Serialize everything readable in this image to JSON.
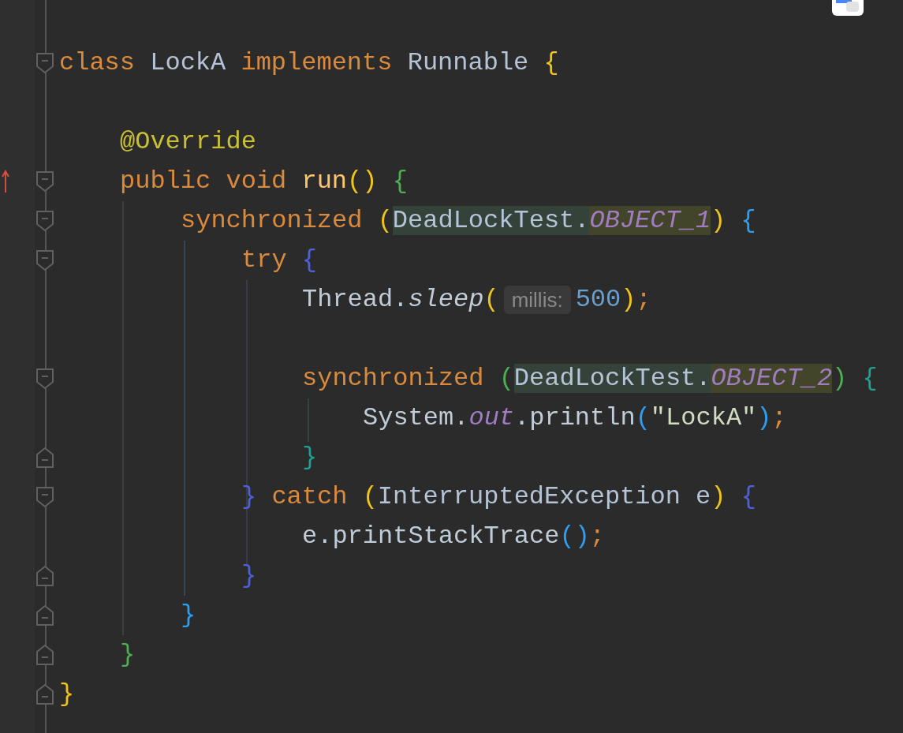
{
  "lines": [
    {
      "kind": "blank"
    },
    {
      "kind": "code",
      "foldable": true,
      "tokens": [
        {
          "kind": "keyword",
          "text": "class "
        },
        {
          "kind": "type",
          "text": "LockA "
        },
        {
          "kind": "keyword",
          "text": "implements "
        },
        {
          "kind": "type",
          "text": "Runnable "
        },
        {
          "kind": "bracket",
          "text": "{",
          "color": "#f0c419"
        }
      ],
      "children": [
        {
          "kind": "blank"
        },
        {
          "kind": "code",
          "tokens": [
            {
              "kind": "annotation",
              "text": "@Override"
            }
          ]
        },
        {
          "kind": "code",
          "foldable": true,
          "override": true,
          "tokens": [
            {
              "kind": "keyword",
              "text": "public void "
            },
            {
              "kind": "method",
              "text": "run"
            },
            {
              "kind": "bracket",
              "text": "()",
              "color": "#f0c419"
            },
            {
              "kind": "bracket",
              "text": " {",
              "color": "#4caf50"
            }
          ],
          "children": [
            {
              "kind": "code",
              "foldable": true,
              "tokens": [
                {
                  "kind": "keyword",
                  "text": "synchronized "
                },
                {
                  "kind": "bracket",
                  "text": "(",
                  "color": "#f0c419"
                },
                {
                  "kind": "type",
                  "text": "DeadLockTest.",
                  "highlighted": true
                },
                {
                  "kind": "static-field",
                  "text": "OBJECT_1",
                  "highlighted": true
                },
                {
                  "kind": "bracket",
                  "text": ")",
                  "color": "#f0c419"
                },
                {
                  "kind": "bracket",
                  "text": " {",
                  "color": "#2f9df0"
                }
              ],
              "children": [
                {
                  "kind": "code",
                  "foldable": true,
                  "tokens": [
                    {
                      "kind": "keyword",
                      "text": "try "
                    },
                    {
                      "kind": "bracket",
                      "text": "{",
                      "color": "#5060d8"
                    }
                  ],
                  "children": [
                    {
                      "kind": "code",
                      "tokens": [
                        {
                          "kind": "plain",
                          "text": "Thread."
                        },
                        {
                          "kind": "static-method",
                          "text": "sleep"
                        },
                        {
                          "kind": "bracket",
                          "text": "(",
                          "color": "#f0c419"
                        },
                        {
                          "kind": "hint",
                          "text": "millis:"
                        },
                        {
                          "kind": "number",
                          "text": "500"
                        },
                        {
                          "kind": "bracket",
                          "text": ")",
                          "color": "#f0c419"
                        },
                        {
                          "kind": "punct",
                          "text": ";"
                        }
                      ]
                    },
                    {
                      "kind": "blank"
                    },
                    {
                      "kind": "code",
                      "foldable": true,
                      "tokens": [
                        {
                          "kind": "keyword",
                          "text": "synchronized "
                        },
                        {
                          "kind": "bracket",
                          "text": "(",
                          "color": "#4caf50"
                        },
                        {
                          "kind": "type",
                          "text": "DeadLockTest.",
                          "highlighted": true
                        },
                        {
                          "kind": "static-field",
                          "text": "OBJECT_2",
                          "highlighted": true
                        },
                        {
                          "kind": "bracket",
                          "text": ")",
                          "color": "#4caf50"
                        },
                        {
                          "kind": "bracket",
                          "text": " {",
                          "color": "#20a090"
                        }
                      ],
                      "children": [
                        {
                          "kind": "code",
                          "tokens": [
                            {
                              "kind": "plain",
                              "text": "System."
                            },
                            {
                              "kind": "static-field",
                              "text": "out"
                            },
                            {
                              "kind": "plain",
                              "text": ".println"
                            },
                            {
                              "kind": "bracket",
                              "text": "(",
                              "color": "#2f9df0"
                            },
                            {
                              "kind": "string",
                              "text": "\"LockA\""
                            },
                            {
                              "kind": "bracket",
                              "text": ")",
                              "color": "#2f9df0"
                            },
                            {
                              "kind": "punct",
                              "text": ";"
                            }
                          ]
                        }
                      ]
                    },
                    {
                      "kind": "code",
                      "fold_end": true,
                      "tokens": [
                        {
                          "kind": "bracket",
                          "text": "}",
                          "color": "#20a090"
                        }
                      ]
                    }
                  ]
                },
                {
                  "kind": "code",
                  "foldable": true,
                  "tokens": [
                    {
                      "kind": "bracket",
                      "text": "}",
                      "color": "#5060d8"
                    },
                    {
                      "kind": "keyword",
                      "text": " catch "
                    },
                    {
                      "kind": "bracket",
                      "text": "(",
                      "color": "#f0c419"
                    },
                    {
                      "kind": "type",
                      "text": "InterruptedException e"
                    },
                    {
                      "kind": "bracket",
                      "text": ")",
                      "color": "#f0c419"
                    },
                    {
                      "kind": "bracket",
                      "text": " {",
                      "color": "#5060d8"
                    }
                  ],
                  "children": [
                    {
                      "kind": "code",
                      "tokens": [
                        {
                          "kind": "plain",
                          "text": "e.printStackTrace"
                        },
                        {
                          "kind": "bracket",
                          "text": "()",
                          "color": "#2f9df0"
                        },
                        {
                          "kind": "punct",
                          "text": ";"
                        }
                      ]
                    }
                  ]
                },
                {
                  "kind": "code",
                  "fold_end": true,
                  "tokens": [
                    {
                      "kind": "bracket",
                      "text": "}",
                      "color": "#5060d8"
                    }
                  ]
                }
              ]
            },
            {
              "kind": "code",
              "fold_end": true,
              "tokens": [
                {
                  "kind": "bracket",
                  "text": "}",
                  "color": "#2f9df0"
                }
              ]
            }
          ]
        },
        {
          "kind": "code",
          "fold_end": true,
          "tokens": [
            {
              "kind": "bracket",
              "text": "}",
              "color": "#4caf50"
            }
          ]
        }
      ]
    },
    {
      "kind": "code",
      "fold_end": true,
      "tokens": [
        {
          "kind": "bracket",
          "text": "}",
          "color": "#f0c419"
        }
      ]
    }
  ]
}
